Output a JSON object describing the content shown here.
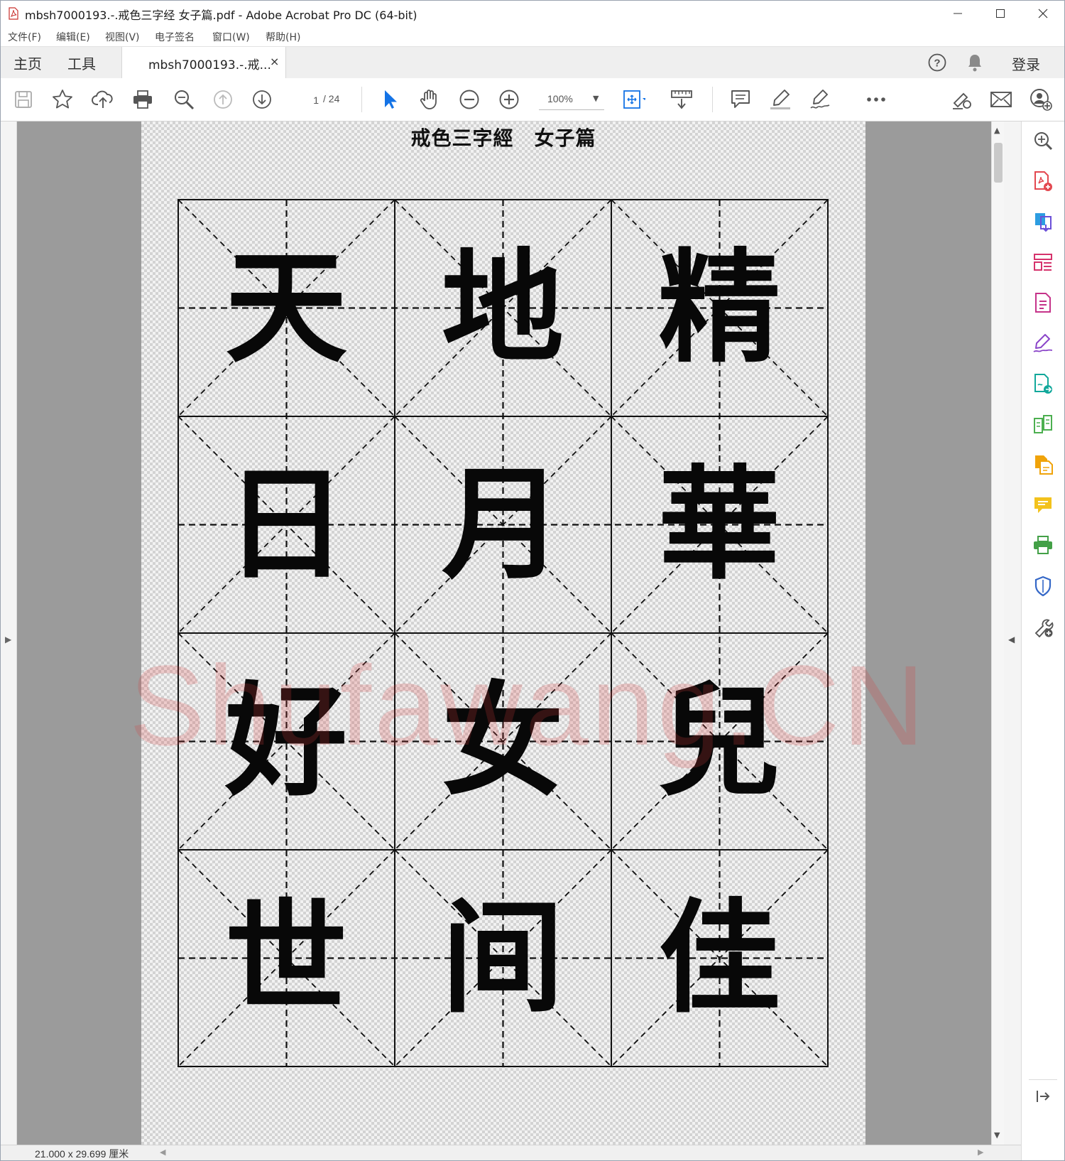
{
  "window": {
    "title": "mbsh7000193.-.戒色三字经 女子篇.pdf - Adobe Acrobat Pro DC (64-bit)",
    "controls": [
      "minimize",
      "maximize",
      "close"
    ]
  },
  "menu": [
    "文件(F)",
    "编辑(E)",
    "视图(V)",
    "电子签名",
    "窗口(W)",
    "帮助(H)"
  ],
  "tabs": {
    "home": "主页",
    "tools": "工具",
    "document": "mbsh7000193.-.戒...",
    "close": "×",
    "signin": "登录"
  },
  "toolbar": {
    "page_current": "1",
    "page_total": "/ 24",
    "zoom": "100%",
    "icons": [
      "save-icon",
      "star-icon",
      "cloud-upload-icon",
      "print-icon",
      "search-zoom-icon",
      "page-up-icon",
      "page-down-icon",
      "select-cursor-icon",
      "hand-icon",
      "zoom-out-icon",
      "zoom-in-icon",
      "fit-page-icon",
      "ruler-icon",
      "comment-icon",
      "highlight-pen-icon",
      "sign-pen-icon",
      "more-icon",
      "share-link-icon",
      "email-icon",
      "add-user-icon"
    ]
  },
  "document": {
    "title": "戒色三字經　女子篇",
    "rows": [
      [
        "天",
        "地",
        "精"
      ],
      [
        "日",
        "月",
        "華"
      ],
      [
        "好",
        "女",
        "兒"
      ],
      [
        "世",
        "间",
        "佳"
      ]
    ],
    "watermark": "Shufawang.CN"
  },
  "right_tools": [
    "enhance-scan-icon",
    "create-pdf-icon",
    "export-pdf-icon",
    "organize-pages-icon",
    "edit-pdf-icon",
    "fill-sign-icon",
    "send-for-signature-icon",
    "compare-icon",
    "combine-files-icon",
    "comment-tool-icon",
    "print-production-icon",
    "protect-icon",
    "more-tools-icon"
  ],
  "status": {
    "page_size": "21.000 x 29.699 厘米"
  },
  "colors": {
    "tab_bg": "#efefef",
    "viewer_bg": "#9b9b9b",
    "accent_blue": "#1473e6",
    "watermark": "#d63c3c"
  }
}
